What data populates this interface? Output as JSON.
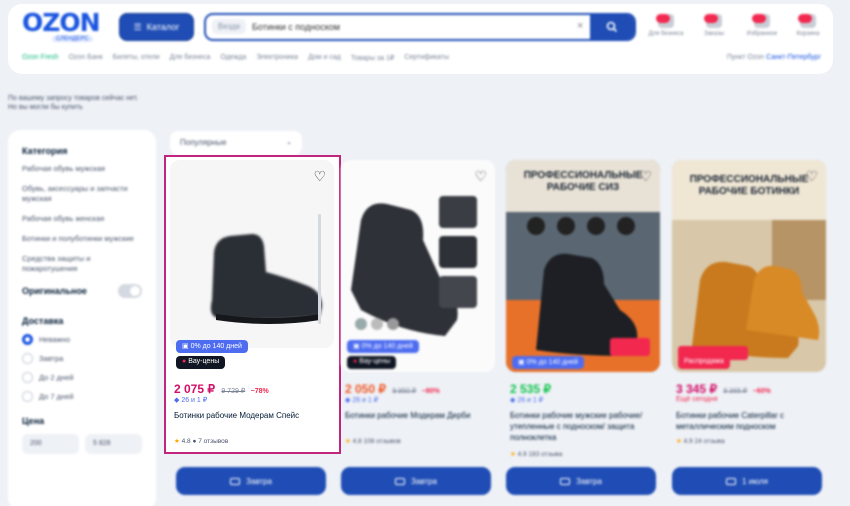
{
  "header": {
    "logo": "OZON",
    "logo_sub": "СЛЕНДЕРС",
    "catalog_label": "Каталог",
    "search_scope": "Везде",
    "search_value": "Ботинки с подноском",
    "actions": [
      {
        "label": "Для бизнеса"
      },
      {
        "label": "Заказы"
      },
      {
        "label": "Избранное"
      },
      {
        "label": "Корзина"
      }
    ],
    "subnav": [
      "Ozon Fresh",
      "Ozon Банк",
      "Билеты, отели",
      "Для бизнеса",
      "Одежда",
      "Электроника",
      "Дом и сад",
      "Товары за 1₽",
      "Сертификаты"
    ],
    "subnav_right_prefix": "Пункт Ozon",
    "subnav_right_link": "Санкт-Петербург"
  },
  "notice": {
    "line1": "По вашему запросу товаров сейчас нет.",
    "line2": "Но вы могли бы купить"
  },
  "sidebar": {
    "category_title": "Категория",
    "categories": [
      "Рабочая обувь мужская",
      "Обувь, аксессуары и запчасти мужская",
      "Рабочая обувь женская",
      "Ботинки и полуботинки мужские",
      "Средства защиты и пожаротушения"
    ],
    "original_label": "Оригинальное",
    "delivery_title": "Доставка",
    "delivery_options": [
      "Неважно",
      "Завтра",
      "До 2 дней",
      "До 7 дней"
    ],
    "price_title": "Цена",
    "price_from": "200",
    "price_to": "5 828"
  },
  "sort": {
    "label": "Популярные"
  },
  "products": [
    {
      "badge1": "0% до 140 дней",
      "badge2": "Вау-цены",
      "price": "2 075 ₽",
      "old_price": "9 729 ₽",
      "discount": "−78%",
      "sub": "26 и 1 ₽",
      "title": "Ботинки рабочие Модерам Спейс",
      "rating": "4.8",
      "reviews": "7 отзывов",
      "cart": "Завтра"
    },
    {
      "badge1": "0% до 140 дней",
      "badge2": "Вау-цены",
      "price": "2 050 ₽",
      "old_price": "9 950 ₽",
      "discount": "−80%",
      "sub": "26 и 1 ₽",
      "title": "Ботинки рабочие Модерам Дерби",
      "rating": "4.8",
      "reviews": "108 отзывов",
      "cart": "Завтра"
    },
    {
      "banner": "ПРОФЕССИОНАЛЬНЫЕ РАБОЧИЕ СИЗ",
      "badge1": "0% до 140 дней",
      "price": "2 535 ₽",
      "old_price": "",
      "discount": "",
      "sub": "26 и 1 ₽",
      "title": "Ботинки рабочие мужские рабочие/утепленные с подноском/ защита полноклетка",
      "rating": "4.9",
      "reviews": "183 отзыва",
      "cart": "Завтра"
    },
    {
      "banner": "ПРОФЕССИОНАЛЬНЫЕ РАБОЧИЕ БОТИНКИ",
      "badge1": "Распродажа",
      "price": "3 345 ₽",
      "old_price": "8 365 ₽",
      "discount": "−60%",
      "sub": "Ещё сегодня",
      "title": "Ботинки рабочие Caterpillar с металлическим подноском",
      "rating": "4.9",
      "reviews": "24 отзыва",
      "cart": "1 июля"
    }
  ],
  "colors": {
    "brand": "#1a55e0",
    "button": "#1f4db5",
    "price": "#d20e66",
    "highlight": "#c0267e"
  }
}
